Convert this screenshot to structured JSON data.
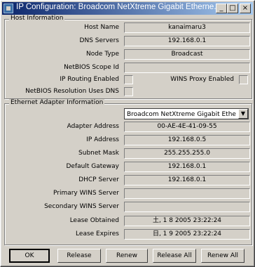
{
  "window": {
    "title": "IP Configuration: Broadcom NetXtreme Gigabit Etherne...",
    "controls": [
      "_",
      "□",
      "×"
    ]
  },
  "host": {
    "group_title": "Host Information",
    "host_name": {
      "label": "Host Name",
      "value": "kanaimaru3"
    },
    "dns_servers": {
      "label": "DNS Servers",
      "value": "192.168.0.1"
    },
    "node_type": {
      "label": "Node Type",
      "value": "Broadcast"
    },
    "netbios_scope": {
      "label": "NetBIOS Scope Id",
      "value": ""
    },
    "ip_routing": {
      "label": "IP Routing Enabled",
      "checked": false
    },
    "wins_proxy": {
      "label": "WINS Proxy Enabled",
      "checked": false
    },
    "netbios_dns": {
      "label": "NetBIOS Resolution Uses DNS",
      "checked": false
    }
  },
  "ethernet": {
    "group_title": "Ethernet  Adapter Information",
    "adapter_select": "Broadcom NetXtreme Gigabit Ethe",
    "adapter_address": {
      "label": "Adapter Address",
      "value": "00-AE-4E-41-09-55"
    },
    "ip_address": {
      "label": "IP Address",
      "value": "192.168.0.5"
    },
    "subnet_mask": {
      "label": "Subnet Mask",
      "value": "255.255.255.0"
    },
    "default_gateway": {
      "label": "Default Gateway",
      "value": "192.168.0.1"
    },
    "dhcp_server": {
      "label": "DHCP Server",
      "value": "192.168.0.1"
    },
    "primary_wins": {
      "label": "Primary WINS Server",
      "value": ""
    },
    "secondary_wins": {
      "label": "Secondary WINS Server",
      "value": ""
    },
    "lease_obtained": {
      "label": "Lease Obtained",
      "value": "土, 1 8 2005 23:22:24"
    },
    "lease_expires": {
      "label": "Lease Expires",
      "value": "日, 1 9 2005 23:22:24"
    }
  },
  "buttons": {
    "ok": "OK",
    "release": "Release",
    "renew": "Renew",
    "release_all": "Release All",
    "renew_all": "Renew All"
  }
}
